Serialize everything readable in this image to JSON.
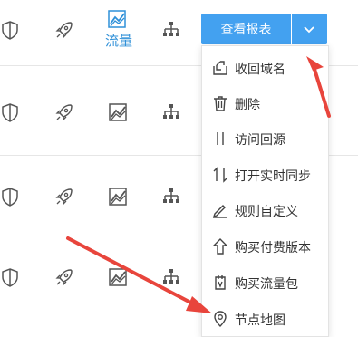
{
  "row1": {
    "traffic_label": "流量"
  },
  "report_button": {
    "label": "查看报表"
  },
  "dropdown": {
    "items": [
      {
        "label": "收回域名",
        "icon": "reclaim-domain-icon"
      },
      {
        "label": "删除",
        "icon": "trash-icon"
      },
      {
        "label": "访问回源",
        "icon": "origin-access-icon"
      },
      {
        "label": "打开实时同步",
        "icon": "sync-icon"
      },
      {
        "label": "规则自定义",
        "icon": "pencil-icon"
      },
      {
        "label": "购买付费版本",
        "icon": "upgrade-arrow-icon"
      },
      {
        "label": "购买流量包",
        "icon": "traffic-package-icon"
      },
      {
        "label": "节点地图",
        "icon": "map-pin-icon"
      }
    ]
  },
  "colors": {
    "accent": "#43a1f0",
    "annotation_arrow": "#e8453c",
    "traffic_active": "#2f90d8"
  }
}
